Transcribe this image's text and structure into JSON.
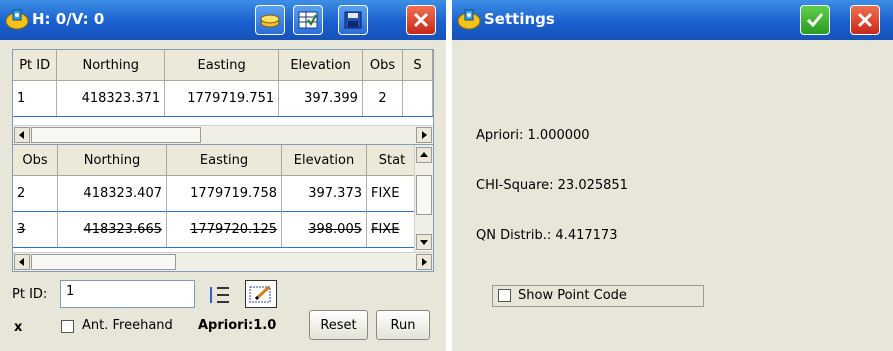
{
  "left_window": {
    "title": "H: 0/V: 0",
    "toolbar": {
      "icons": [
        "coins-icon",
        "table-check-icon",
        "floppy-disk-icon",
        "close-icon"
      ]
    },
    "top_table": {
      "headers": [
        "Pt ID",
        "Northing",
        "Easting",
        "Elevation",
        "Obs",
        "S"
      ],
      "rows": [
        {
          "pt_id": "1",
          "northing": "418323.371",
          "easting": "1779719.751",
          "elevation": "397.399",
          "obs": "2"
        }
      ]
    },
    "bottom_table": {
      "headers": [
        "Obs",
        "Northing",
        "Easting",
        "Elevation",
        "Stat"
      ],
      "rows": [
        {
          "obs": "2",
          "northing": "418323.407",
          "easting": "1779719.758",
          "elevation": "397.373",
          "stat": "FIXE"
        },
        {
          "obs": "3",
          "northing": "418323.665",
          "easting": "1779720.125",
          "elevation": "398.005",
          "stat": "FIXE"
        }
      ]
    },
    "pt_id_label": "Pt ID:",
    "pt_id_value": "1",
    "x_label": "x",
    "ant_freehand_label": "Ant. Freehand",
    "apriori_text": "Apriori:1.0",
    "reset_label": "Reset",
    "run_label": "Run"
  },
  "right_window": {
    "title": "Settings",
    "apriori": "Apriori: 1.000000",
    "chi_square": "CHI-Square: 23.025851",
    "qn_distrib": "QN Distrib.: 4.417173",
    "show_point_code": "Show Point Code"
  },
  "colors": {
    "titlebar": "#1a5fcf",
    "panel_bg": "#e8e6d8",
    "close_red": "#d83820",
    "ok_green": "#2fa82a",
    "selection_line": "#3070d8"
  }
}
